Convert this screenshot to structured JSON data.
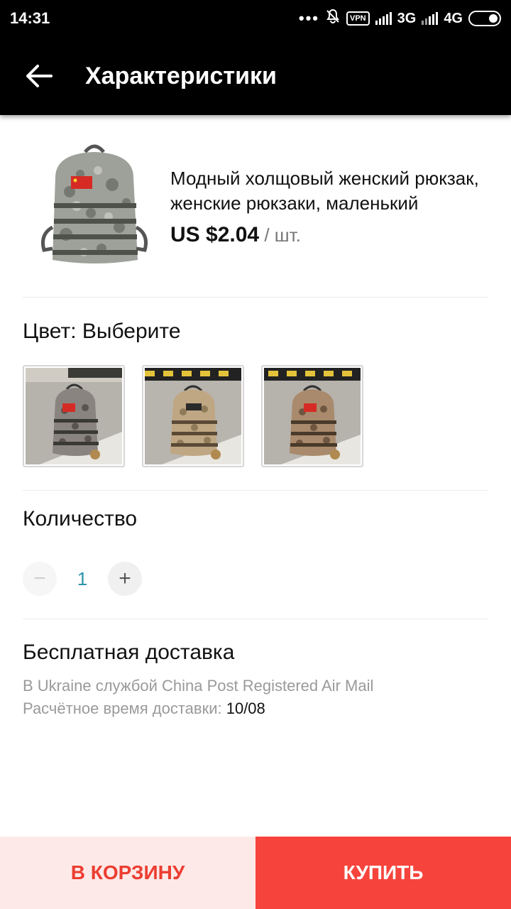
{
  "status_bar": {
    "time": "14:31",
    "vpn": "VPN",
    "net1": "3G",
    "net2": "4G",
    "icons": [
      "more-dots-icon",
      "bell-off-icon",
      "vpn-icon",
      "signal-icon",
      "battery-icon"
    ]
  },
  "app_bar": {
    "title": "Характеристики",
    "back_icon": "arrow-left-icon"
  },
  "product": {
    "title": "Модный холщовый женский рюкзак, женские рюкзаки, маленький",
    "price": "US $2.04",
    "unit": " / шт."
  },
  "color": {
    "label": "Цвет: Выберите",
    "options": [
      "gray-camo",
      "sand-camo",
      "desert-camo"
    ]
  },
  "quantity": {
    "label": "Количество",
    "value": "1",
    "minus": "−",
    "plus": "+"
  },
  "shipping": {
    "title": "Бесплатная доставка",
    "method": "В Ukraine службой China Post Registered Air Mail",
    "eta_label": "Расчётное время доставки: ",
    "eta_value": "10/08"
  },
  "actions": {
    "cart": "В КОРЗИНУ",
    "buy": "КУПИТЬ"
  },
  "colors": {
    "accent": "#f6443c",
    "accent_light": "#fde9e7",
    "qty_text": "#2c93a8"
  }
}
